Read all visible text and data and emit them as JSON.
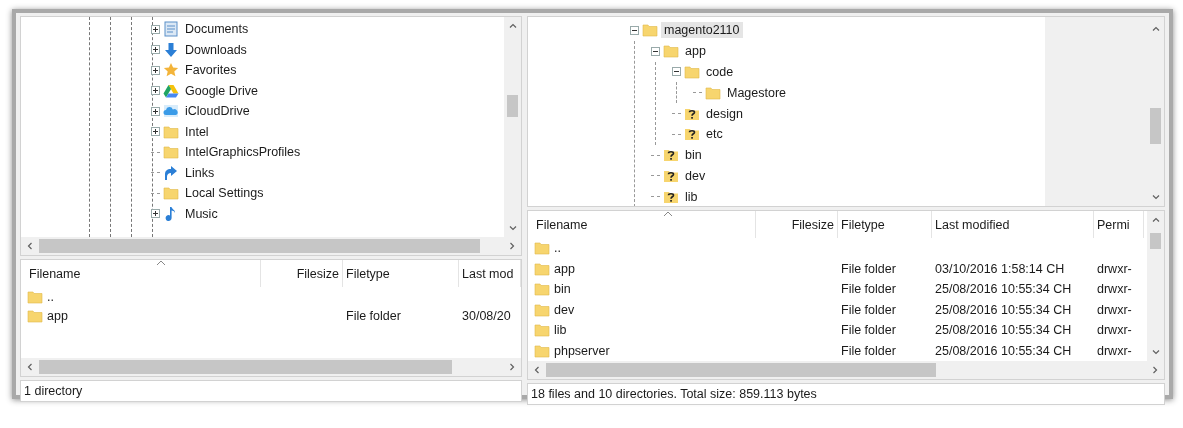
{
  "local_tree": {
    "items": [
      {
        "label": "Documents",
        "kind": "documents",
        "expanded": false
      },
      {
        "label": "Downloads",
        "kind": "download",
        "expanded": false
      },
      {
        "label": "Favorites",
        "kind": "star",
        "expanded": false
      },
      {
        "label": "Google Drive",
        "kind": "drive",
        "expanded": false
      },
      {
        "label": "iCloudDrive",
        "kind": "cloud",
        "expanded": false
      },
      {
        "label": "Intel",
        "kind": "folder",
        "expanded": false
      },
      {
        "label": "IntelGraphicsProfiles",
        "kind": "folder"
      },
      {
        "label": "Links",
        "kind": "link"
      },
      {
        "label": "Local Settings",
        "kind": "folder"
      },
      {
        "label": "Music",
        "kind": "music",
        "expanded": false
      }
    ]
  },
  "local_list": {
    "columns": [
      "Filename",
      "Filesize",
      "Filetype",
      "Last mod"
    ],
    "rows": [
      {
        "name": ".."
      },
      {
        "name": "app",
        "filetype": "File folder",
        "last_modified": "30/08/20"
      }
    ]
  },
  "local_status": "1 directory",
  "remote_tree": {
    "items": [
      {
        "label": "magento2110",
        "kind": "folder",
        "selected": true,
        "expanded": true,
        "children": [
          {
            "label": "app",
            "kind": "folder",
            "selected": false,
            "expanded": true,
            "children": [
              {
                "label": "code",
                "kind": "folder",
                "selected": false,
                "expanded": true,
                "children": [
                  {
                    "label": "Magestore",
                    "kind": "folder",
                    "selected": false
                  }
                ]
              },
              {
                "label": "design",
                "kind": "unknown",
                "selected": false
              },
              {
                "label": "etc",
                "kind": "unknown",
                "selected": false
              }
            ]
          },
          {
            "label": "bin",
            "kind": "unknown",
            "selected": false
          },
          {
            "label": "dev",
            "kind": "unknown",
            "selected": false
          },
          {
            "label": "lib",
            "kind": "unknown",
            "selected": false
          }
        ]
      }
    ]
  },
  "remote_list": {
    "columns": [
      "Filename",
      "Filesize",
      "Filetype",
      "Last modified",
      "Permi"
    ],
    "rows": [
      {
        "name": ".."
      },
      {
        "name": "app",
        "filetype": "File folder",
        "last_modified": "03/10/2016 1:58:14 CH",
        "permissions": "drwxr-"
      },
      {
        "name": "bin",
        "filetype": "File folder",
        "last_modified": "25/08/2016 10:55:34 CH",
        "permissions": "drwxr-"
      },
      {
        "name": "dev",
        "filetype": "File folder",
        "last_modified": "25/08/2016 10:55:34 CH",
        "permissions": "drwxr-"
      },
      {
        "name": "lib",
        "filetype": "File folder",
        "last_modified": "25/08/2016 10:55:34 CH",
        "permissions": "drwxr-"
      },
      {
        "name": "phpserver",
        "filetype": "File folder",
        "last_modified": "25/08/2016 10:55:34 CH",
        "permissions": "drwxr-"
      }
    ]
  },
  "remote_status": "18 files and 10 directories. Total size: 859.113 bytes"
}
